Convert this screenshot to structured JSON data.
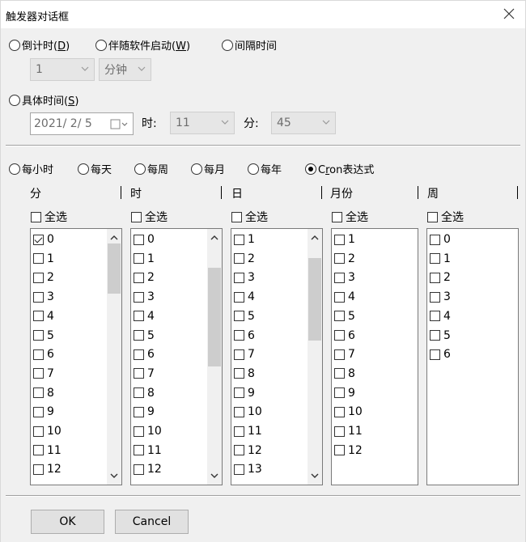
{
  "title": "触发器对话框",
  "modes": {
    "countdown": {
      "pre": "倒计时(",
      "key": "D",
      "post": ")"
    },
    "with_software": {
      "pre": "伴随软件启动(",
      "key": "W",
      "post": ")"
    },
    "interval": "间隔时间",
    "specific": {
      "pre": "具体时间(",
      "key": "S",
      "post": ")"
    }
  },
  "countdown_value": "1",
  "countdown_unit": "分钟",
  "date_value": "2021/  2/  5",
  "hour_label": "时:",
  "hour_value": "11",
  "minute_label": "分:",
  "minute_value": "45",
  "freq": {
    "hourly": "每小时",
    "daily": "每天",
    "weekly": "每周",
    "monthly": "每月",
    "yearly": "每年",
    "cron": {
      "pre": "C",
      "key": "r",
      "post": "on表达式"
    },
    "selected": "cron"
  },
  "columns": [
    {
      "header": "分",
      "select_all": "全选",
      "items": [
        "0",
        "1",
        "2",
        "3",
        "4",
        "5",
        "6",
        "7",
        "8",
        "9",
        "10",
        "11",
        "12"
      ],
      "checked": [
        0
      ]
    },
    {
      "header": "时",
      "select_all": "全选",
      "items": [
        "0",
        "1",
        "2",
        "3",
        "4",
        "5",
        "6",
        "7",
        "8",
        "9",
        "10",
        "11",
        "12"
      ],
      "checked": []
    },
    {
      "header": "日",
      "select_all": "全选",
      "items": [
        "1",
        "2",
        "3",
        "4",
        "5",
        "6",
        "7",
        "8",
        "9",
        "10",
        "11",
        "12",
        "13"
      ],
      "checked": []
    },
    {
      "header": "月份",
      "select_all": "全选",
      "items": [
        "1",
        "2",
        "3",
        "4",
        "5",
        "6",
        "7",
        "8",
        "9",
        "10",
        "11",
        "12"
      ],
      "checked": []
    },
    {
      "header": "周",
      "select_all": "全选",
      "items": [
        "0",
        "1",
        "2",
        "3",
        "4",
        "5",
        "6"
      ],
      "checked": []
    }
  ],
  "buttons": {
    "ok": "OK",
    "cancel": "Cancel"
  }
}
